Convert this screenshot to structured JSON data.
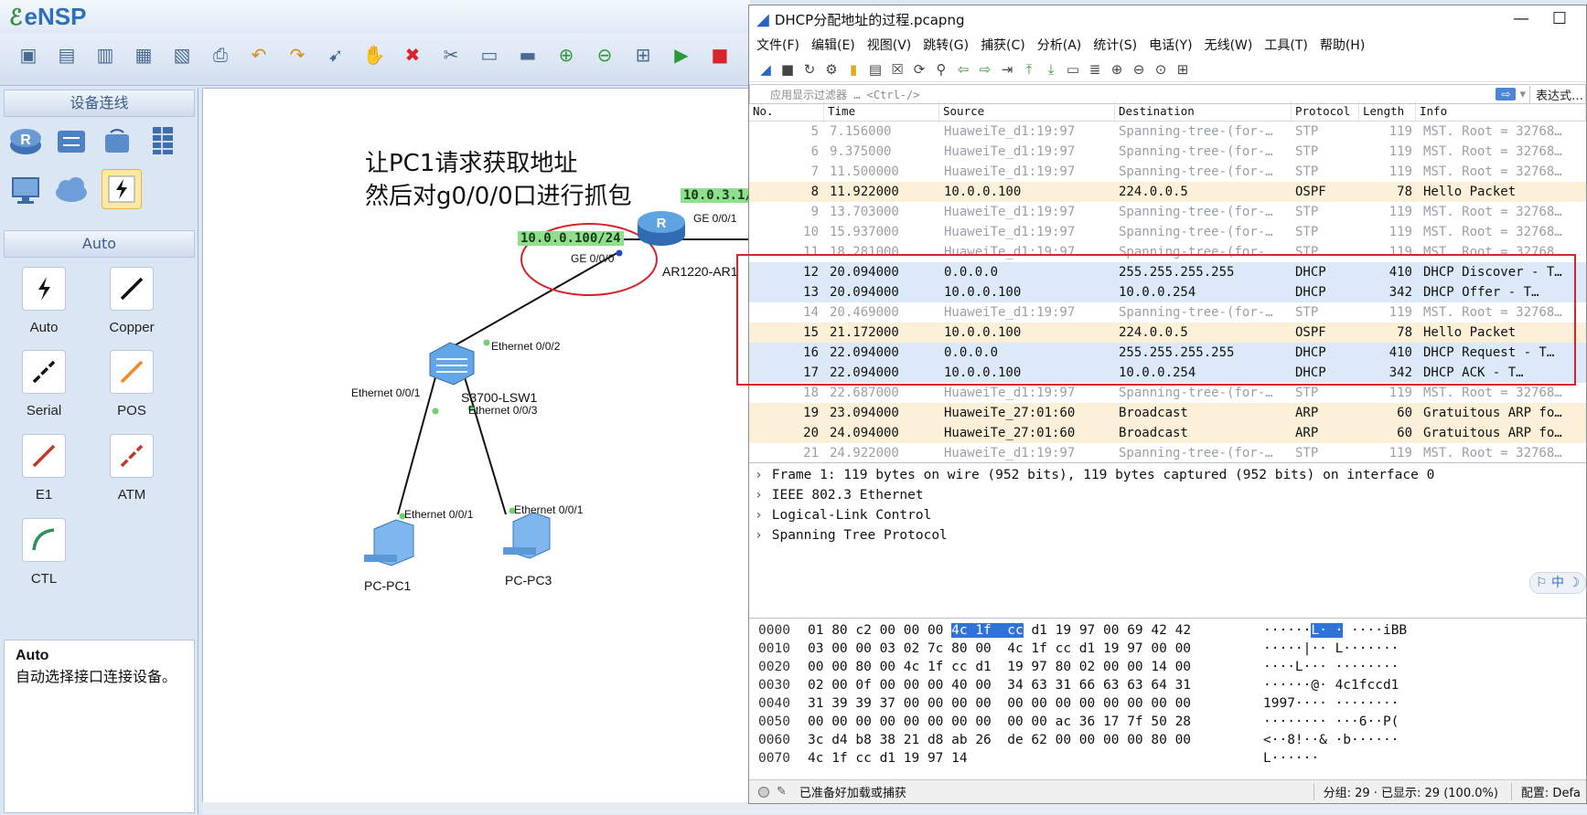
{
  "ensp": {
    "logo": "eNSP",
    "toolbar_icons": [
      "new-topology-icon",
      "new-device-icon",
      "open-icon",
      "save-icon",
      "save-as-icon",
      "print-icon",
      "undo-icon",
      "redo-icon",
      "select-icon",
      "hand-icon",
      "delete-icon",
      "delete-link-icon",
      "text-icon",
      "rectangle-icon",
      "zoom-in-icon",
      "zoom-out-icon",
      "topo-icon",
      "start-icon",
      "stop-icon"
    ],
    "device_section_title": "设备连线",
    "auto_section_title": "Auto",
    "cables": [
      {
        "label": "Auto",
        "icon": "auto-cable-icon",
        "color": "#111111"
      },
      {
        "label": "Copper",
        "icon": "copper-cable-icon",
        "color": "#111111"
      },
      {
        "label": "Serial",
        "icon": "serial-cable-icon",
        "color": "#111111"
      },
      {
        "label": "POS",
        "icon": "pos-cable-icon",
        "color": "#f08a24"
      },
      {
        "label": "E1",
        "icon": "e1-cable-icon",
        "color": "#c0392b"
      },
      {
        "label": "ATM",
        "icon": "atm-cable-icon",
        "color": "#c0392b"
      },
      {
        "label": "CTL",
        "icon": "ctl-cable-icon",
        "color": "#2f8f5f"
      }
    ],
    "help_title": "Auto",
    "help_text": "自动选择接口连接设备。",
    "canvas": {
      "note_line1": "让PC1请求获取地址",
      "note_line2": "然后对g0/0/0口进行抓包",
      "ip_tag_router_g000": "10.0.0.100/24",
      "ip_tag_router_g001": "10.0.3.1/",
      "router_name": "AR1220-AR1",
      "router_port_g000": "GE 0/0/0",
      "router_port_g001": "GE 0/0/1",
      "switch_name": "S3700-LSW1",
      "switch_port_02": "Ethernet 0/0/2",
      "switch_port_01": "Ethernet 0/0/1",
      "switch_port_03": "Ethernet 0/0/3",
      "pc1_port": "Ethernet 0/0/1",
      "pc3_port": "Ethernet 0/0/1",
      "pc1_name": "PC-PC1",
      "pc3_name": "PC-PC3"
    }
  },
  "wireshark": {
    "title": "DHCP分配地址的过程.pcapng",
    "menu": [
      "文件(F)",
      "编辑(E)",
      "视图(V)",
      "跳转(G)",
      "捕获(C)",
      "分析(A)",
      "统计(S)",
      "电话(Y)",
      "无线(W)",
      "工具(T)",
      "帮助(H)"
    ],
    "filter_placeholder": "应用显示过滤器 … <Ctrl-/>",
    "filter_expr_label": "表达式…",
    "columns": [
      "No.",
      "Time",
      "Source",
      "Destination",
      "Protocol",
      "Length",
      "Info"
    ],
    "packets": [
      {
        "no": "5",
        "time": "7.156000",
        "src": "HuaweiTe_d1:19:97",
        "dst": "Spanning-tree-(for-…",
        "proto": "STP",
        "len": "119",
        "info": "MST. Root = 32768…",
        "kind": "stp"
      },
      {
        "no": "6",
        "time": "9.375000",
        "src": "HuaweiTe_d1:19:97",
        "dst": "Spanning-tree-(for-…",
        "proto": "STP",
        "len": "119",
        "info": "MST. Root = 32768…",
        "kind": "stp"
      },
      {
        "no": "7",
        "time": "11.500000",
        "src": "HuaweiTe_d1:19:97",
        "dst": "Spanning-tree-(for-…",
        "proto": "STP",
        "len": "119",
        "info": "MST. Root = 32768…",
        "kind": "stp"
      },
      {
        "no": "8",
        "time": "11.922000",
        "src": "10.0.0.100",
        "dst": "224.0.0.5",
        "proto": "OSPF",
        "len": "78",
        "info": "Hello Packet",
        "kind": "ospf"
      },
      {
        "no": "9",
        "time": "13.703000",
        "src": "HuaweiTe_d1:19:97",
        "dst": "Spanning-tree-(for-…",
        "proto": "STP",
        "len": "119",
        "info": "MST. Root = 32768…",
        "kind": "stp"
      },
      {
        "no": "10",
        "time": "15.937000",
        "src": "HuaweiTe_d1:19:97",
        "dst": "Spanning-tree-(for-…",
        "proto": "STP",
        "len": "119",
        "info": "MST. Root = 32768…",
        "kind": "stp"
      },
      {
        "no": "11",
        "time": "18.281000",
        "src": "HuaweiTe_d1:19:97",
        "dst": "Spanning-tree-(for-…",
        "proto": "STP",
        "len": "119",
        "info": "MST. Root = 32768…",
        "kind": "stp"
      },
      {
        "no": "12",
        "time": "20.094000",
        "src": "0.0.0.0",
        "dst": "255.255.255.255",
        "proto": "DHCP",
        "len": "410",
        "info": "DHCP Discover  - T…",
        "kind": "dhcp"
      },
      {
        "no": "13",
        "time": "20.094000",
        "src": "10.0.0.100",
        "dst": "10.0.0.254",
        "proto": "DHCP",
        "len": "342",
        "info": "DHCP Offer     - T…",
        "kind": "dhcp"
      },
      {
        "no": "14",
        "time": "20.469000",
        "src": "HuaweiTe_d1:19:97",
        "dst": "Spanning-tree-(for-…",
        "proto": "STP",
        "len": "119",
        "info": "MST. Root = 32768…",
        "kind": "stp"
      },
      {
        "no": "15",
        "time": "21.172000",
        "src": "10.0.0.100",
        "dst": "224.0.0.5",
        "proto": "OSPF",
        "len": "78",
        "info": "Hello Packet",
        "kind": "ospf"
      },
      {
        "no": "16",
        "time": "22.094000",
        "src": "0.0.0.0",
        "dst": "255.255.255.255",
        "proto": "DHCP",
        "len": "410",
        "info": "DHCP Request   - T…",
        "kind": "dhcp"
      },
      {
        "no": "17",
        "time": "22.094000",
        "src": "10.0.0.100",
        "dst": "10.0.0.254",
        "proto": "DHCP",
        "len": "342",
        "info": "DHCP ACK       - T…",
        "kind": "dhcp"
      },
      {
        "no": "18",
        "time": "22.687000",
        "src": "HuaweiTe_d1:19:97",
        "dst": "Spanning-tree-(for-…",
        "proto": "STP",
        "len": "119",
        "info": "MST. Root = 32768…",
        "kind": "stp"
      },
      {
        "no": "19",
        "time": "23.094000",
        "src": "HuaweiTe_27:01:60",
        "dst": "Broadcast",
        "proto": "ARP",
        "len": "60",
        "info": "Gratuitous ARP fo…",
        "kind": "arp"
      },
      {
        "no": "20",
        "time": "24.094000",
        "src": "HuaweiTe_27:01:60",
        "dst": "Broadcast",
        "proto": "ARP",
        "len": "60",
        "info": "Gratuitous ARP fo…",
        "kind": "arp"
      },
      {
        "no": "21",
        "time": "24.922000",
        "src": "HuaweiTe_d1:19:97",
        "dst": "Spanning-tree-(for-…",
        "proto": "STP",
        "len": "119",
        "info": "MST. Root = 32768…",
        "kind": "stp"
      }
    ],
    "details": [
      "Frame 1: 119 bytes on wire (952 bits), 119 bytes captured (952 bits) on interface 0",
      "IEEE 802.3 Ethernet",
      "Logical-Link Control",
      "Spanning Tree Protocol"
    ],
    "ime_label": "中",
    "hex": [
      {
        "off": "0000",
        "pre": "01 80 c2 00 00 00 ",
        "hl": "4c 1f  cc",
        "post": " d1 19 97 00 69 42 42",
        "apre": "······",
        "ahl": "L· ·",
        "apost": " ····iBB"
      },
      {
        "off": "0010",
        "pre": "03 00 00 03 02 7c 80 00  4c 1f cc d1 19 97 00 00",
        "hl": "",
        "post": "",
        "apre": "·····|·· L·······",
        "ahl": "",
        "apost": ""
      },
      {
        "off": "0020",
        "pre": "00 00 80 00 4c 1f cc d1  19 97 80 02 00 00 14 00",
        "hl": "",
        "post": "",
        "apre": "····L··· ········",
        "ahl": "",
        "apost": ""
      },
      {
        "off": "0030",
        "pre": "02 00 0f 00 00 00 40 00  34 63 31 66 63 63 64 31",
        "hl": "",
        "post": "",
        "apre": "······@· 4c1fccd1",
        "ahl": "",
        "apost": ""
      },
      {
        "off": "0040",
        "pre": "31 39 39 37 00 00 00 00  00 00 00 00 00 00 00 00",
        "hl": "",
        "post": "",
        "apre": "1997···· ········",
        "ahl": "",
        "apost": ""
      },
      {
        "off": "0050",
        "pre": "00 00 00 00 00 00 00 00  00 00 ac 36 17 7f 50 28",
        "hl": "",
        "post": "",
        "apre": "········ ···6··P(",
        "ahl": "",
        "apost": ""
      },
      {
        "off": "0060",
        "pre": "3c d4 b8 38 21 d8 ab 26  de 62 00 00 00 00 80 00",
        "hl": "",
        "post": "",
        "apre": "<··8!··& ·b······",
        "ahl": "",
        "apost": ""
      },
      {
        "off": "0070",
        "pre": "4c 1f cc d1 19 97 14",
        "hl": "",
        "post": "",
        "apre": "L······",
        "ahl": "",
        "apost": ""
      }
    ],
    "status": {
      "ready": "已准备好加载或捕获",
      "packets": "分组: 29 · 已显示: 29 (100.0%)",
      "profile": "配置: Defa"
    }
  }
}
